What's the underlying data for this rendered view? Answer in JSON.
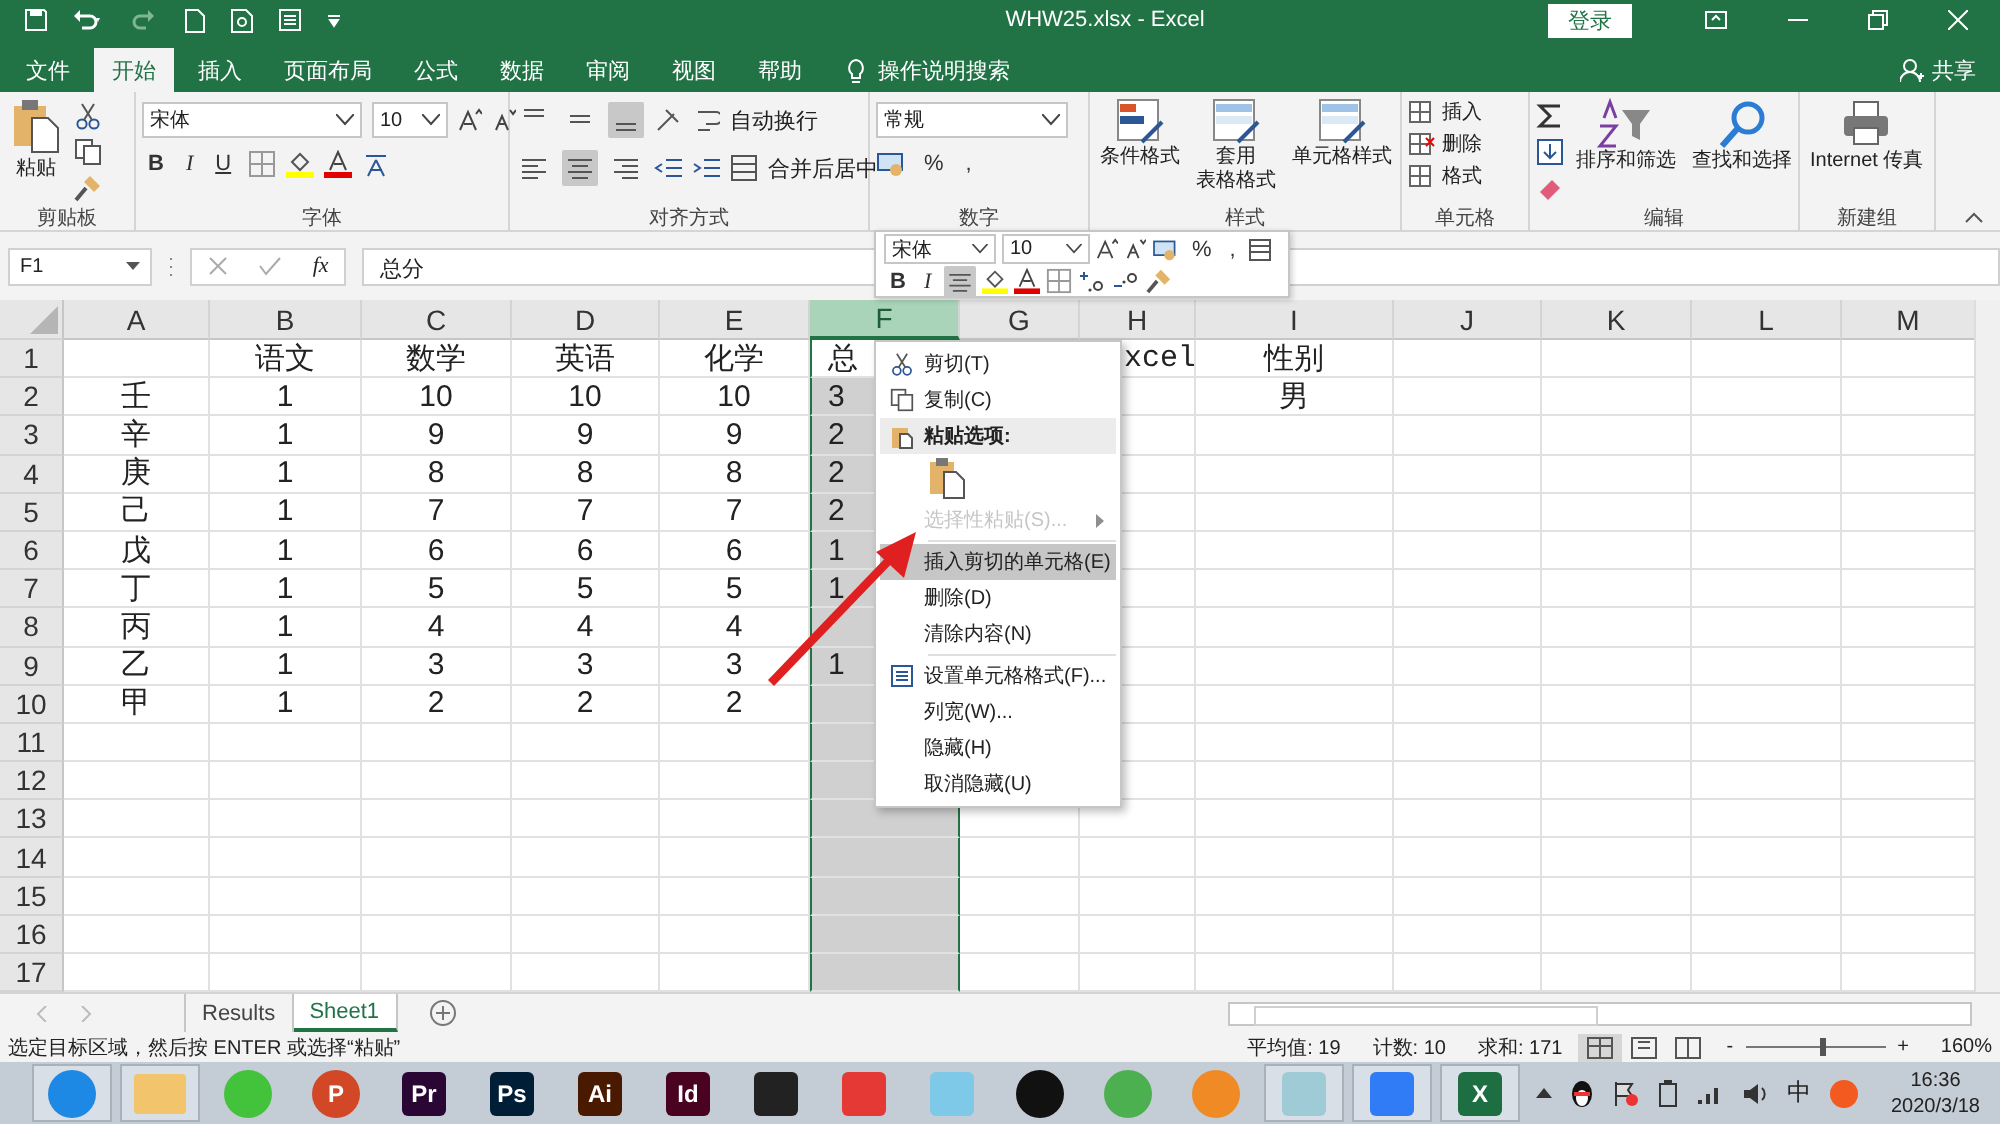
{
  "title_bar": {
    "title": "WHW25.xlsx  -  Excel",
    "login": "登录"
  },
  "ribbon_tabs": [
    {
      "label": "文件",
      "selected": false
    },
    {
      "label": "开始",
      "selected": true
    },
    {
      "label": "插入",
      "selected": false
    },
    {
      "label": "页面布局",
      "selected": false
    },
    {
      "label": "公式",
      "selected": false
    },
    {
      "label": "数据",
      "selected": false
    },
    {
      "label": "审阅",
      "selected": false
    },
    {
      "label": "视图",
      "selected": false
    },
    {
      "label": "帮助",
      "selected": false
    }
  ],
  "tell_me": "操作说明搜索",
  "share": "共享",
  "clipboard": {
    "paste": "粘贴",
    "label": "剪贴板"
  },
  "font": {
    "name": "宋体",
    "size": "10",
    "bold": "B",
    "italic": "I",
    "underline": "U",
    "label": "字体"
  },
  "alignment": {
    "vertical": [
      {
        "selected": false
      },
      {
        "selected": false
      },
      {
        "selected": true
      }
    ],
    "horizontal": [
      {
        "selected": false
      },
      {
        "selected": true
      },
      {
        "selected": false
      }
    ],
    "wrap": "自动换行",
    "merge": "合并后居中",
    "label": "对齐方式"
  },
  "number": {
    "format": "常规",
    "percent": "%",
    "comma": ",",
    "label": "数字"
  },
  "styles": {
    "buttons": [
      {
        "lines": [
          "条件格式"
        ]
      },
      {
        "lines": [
          "套用",
          "表格格式"
        ]
      },
      {
        "lines": [
          "单元格样式"
        ]
      }
    ],
    "label": "样式"
  },
  "cells": {
    "buttons": [
      "插入",
      "删除",
      "格式"
    ],
    "label": "单元格"
  },
  "editing": {
    "buttons": [
      "排序和筛选",
      "查找和选择"
    ],
    "label": "编辑"
  },
  "new_group": {
    "button": "Internet 传真",
    "label": "新建组"
  },
  "formula_bar": {
    "name_box": "F1",
    "fx": "fx",
    "content": "总分"
  },
  "sheet": {
    "columns": [
      {
        "label": "A",
        "selected": false
      },
      {
        "label": "B",
        "selected": false
      },
      {
        "label": "C",
        "selected": false
      },
      {
        "label": "D",
        "selected": false
      },
      {
        "label": "E",
        "selected": false
      },
      {
        "label": "F",
        "selected": true
      },
      {
        "label": "G",
        "selected": false
      },
      {
        "label": "H",
        "selected": false
      },
      {
        "label": "I",
        "selected": false
      },
      {
        "label": "J",
        "selected": false
      },
      {
        "label": "K",
        "selected": false
      },
      {
        "label": "L",
        "selected": false
      },
      {
        "label": "M",
        "selected": false
      }
    ],
    "rows": [
      {
        "label": "1",
        "cells": [
          null,
          "语文",
          "数学",
          "英语",
          "化学",
          "总",
          null,
          "xcel",
          "性别"
        ]
      },
      {
        "label": "2",
        "cells": [
          "壬",
          "1",
          "10",
          "10",
          "10",
          "3",
          null,
          null,
          "男"
        ]
      },
      {
        "label": "3",
        "cells": [
          "辛",
          "1",
          "9",
          "9",
          "9",
          "2"
        ]
      },
      {
        "label": "4",
        "cells": [
          "庚",
          "1",
          "8",
          "8",
          "8",
          "2"
        ]
      },
      {
        "label": "5",
        "cells": [
          "己",
          "1",
          "7",
          "7",
          "7",
          "2"
        ]
      },
      {
        "label": "6",
        "cells": [
          "戊",
          "1",
          "6",
          "6",
          "6",
          "1"
        ]
      },
      {
        "label": "7",
        "cells": [
          "丁",
          "1",
          "5",
          "5",
          "5",
          "1"
        ]
      },
      {
        "label": "8",
        "cells": [
          "丙",
          "1",
          "4",
          "4",
          "4"
        ]
      },
      {
        "label": "9",
        "cells": [
          "乙",
          "1",
          "3",
          "3",
          "3",
          "1"
        ]
      },
      {
        "label": "10",
        "cells": [
          "甲",
          "1",
          "2",
          "2",
          "2"
        ]
      },
      {
        "label": "11"
      },
      {
        "label": "12"
      },
      {
        "label": "13"
      },
      {
        "label": "14"
      },
      {
        "label": "15"
      },
      {
        "label": "16"
      },
      {
        "label": "17"
      }
    ]
  },
  "mini_toolbar": {
    "font": "宋体",
    "size": "10",
    "percent": "%",
    "comma": ",",
    "bold": "B",
    "italic": "I",
    "center_selected": true
  },
  "context_menu": [
    {
      "kind": "cut",
      "label": "剪切(T)",
      "selected": false,
      "disabled": false
    },
    {
      "kind": "copy",
      "label": "复制(C)",
      "selected": false,
      "disabled": false
    },
    {
      "kind": "header",
      "label": "粘贴选项:"
    },
    {
      "kind": "paste_option"
    },
    {
      "kind": "submenu",
      "label": "选择性粘贴(S)...",
      "selected": false,
      "disabled": true
    },
    {
      "kind": "item",
      "label": "插入剪切的单元格(E)",
      "selected": true,
      "disabled": false,
      "separator_before": true
    },
    {
      "kind": "item",
      "label": "删除(D)",
      "selected": false,
      "disabled": false
    },
    {
      "kind": "item",
      "label": "清除内容(N)",
      "selected": false,
      "disabled": false
    },
    {
      "kind": "format",
      "label": "设置单元格格式(F)...",
      "selected": false,
      "disabled": false,
      "separator_before": true
    },
    {
      "kind": "item",
      "label": "列宽(W)...",
      "selected": false,
      "disabled": false
    },
    {
      "kind": "item",
      "label": "隐藏(H)",
      "selected": false,
      "disabled": false
    },
    {
      "kind": "item",
      "label": "取消隐藏(U)",
      "selected": false,
      "disabled": false
    }
  ],
  "sheet_tabs": [
    {
      "label": "Results",
      "selected": false
    },
    {
      "label": "Sheet1",
      "selected": true
    }
  ],
  "status_bar": {
    "message": "选定目标区域，然后按 ENTER 或选择“粘贴”",
    "average": "平均值: 19",
    "count": "计数: 10",
    "sum": "求和: 171",
    "views": [
      {
        "selected": true
      },
      {
        "selected": false
      },
      {
        "selected": false
      }
    ],
    "zoom_minus": "-",
    "zoom_plus": "+",
    "zoom_slider": {
      "level": 0.55
    },
    "zoom": "160%"
  },
  "taskbar": {
    "apps": [
      {
        "kind": "round",
        "color": "#1e88e5",
        "open": true
      },
      {
        "kind": "folder",
        "color": "#f2c46b",
        "open": true
      },
      {
        "kind": "round",
        "color": "#43c33b",
        "open": false
      },
      {
        "kind": "round",
        "color": "#d24726",
        "text": "P",
        "open": false
      },
      {
        "kind": "tile",
        "color": "#2a0634",
        "text": "Pr",
        "open": false
      },
      {
        "kind": "tile",
        "color": "#001e36",
        "text": "Ps",
        "open": false
      },
      {
        "kind": "tile",
        "color": "#4a1a00",
        "text": "Ai",
        "open": false
      },
      {
        "kind": "tile",
        "color": "#49021f",
        "text": "Id",
        "open": false
      },
      {
        "kind": "tile",
        "color": "#222222",
        "open": false
      },
      {
        "kind": "tile",
        "color": "#e53935",
        "open": false
      },
      {
        "kind": "tile",
        "color": "#7ec8e8",
        "open": false
      },
      {
        "kind": "round",
        "color": "#111111",
        "open": false
      },
      {
        "kind": "round",
        "color": "#4caf50",
        "open": false
      },
      {
        "kind": "round",
        "color": "#f08a24",
        "open": false
      },
      {
        "kind": "tile",
        "color": "#9ecbd6",
        "open": true
      },
      {
        "kind": "tile",
        "color": "#2f7cf6",
        "open": true
      },
      {
        "kind": "tile",
        "color": "#1d6f42",
        "text": "X",
        "open": true
      }
    ],
    "ime": "中",
    "time": "16:36",
    "date": "2020/3/18"
  }
}
